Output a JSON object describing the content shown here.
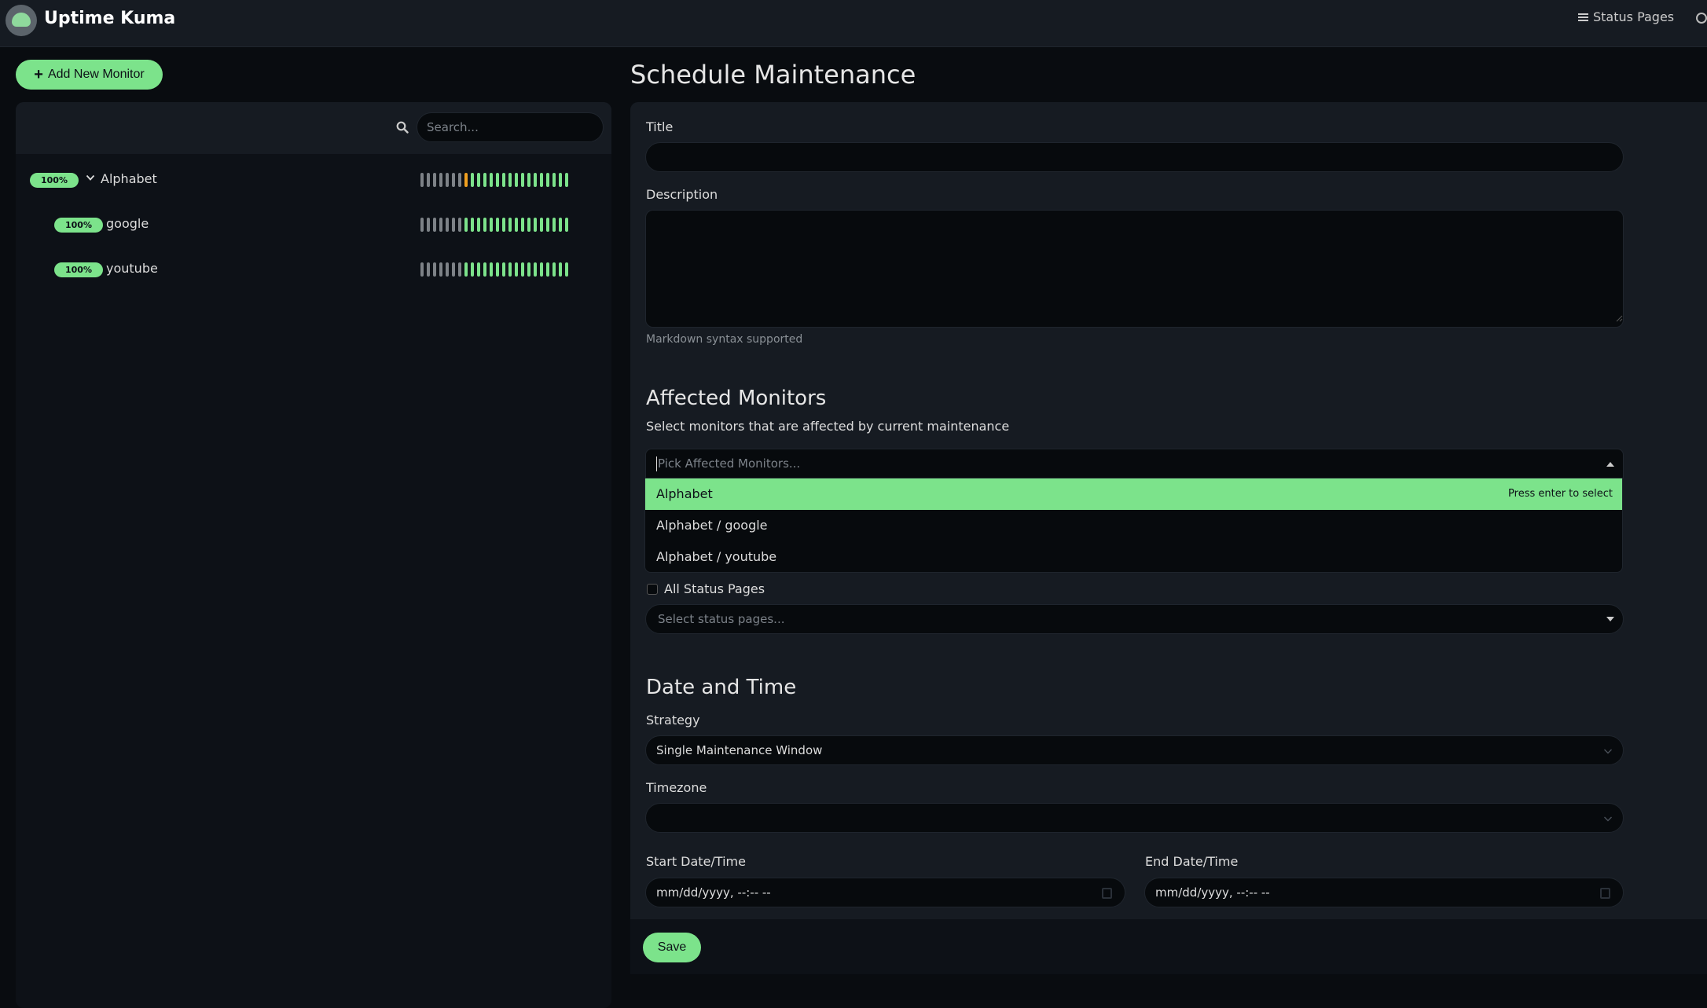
{
  "header": {
    "brand": "Uptime Kuma",
    "status_pages_label": "Status Pages"
  },
  "sidebar": {
    "add_monitor_label": "Add New Monitor",
    "search_placeholder": "Search...",
    "monitors": [
      {
        "name": "Alphabet",
        "uptime": "100%",
        "group": true
      },
      {
        "name": "google",
        "uptime": "100%",
        "group": false
      },
      {
        "name": "youtube",
        "uptime": "100%",
        "group": false
      }
    ]
  },
  "main": {
    "page_title": "Schedule Maintenance",
    "title_label": "Title",
    "title_value": "",
    "description_label": "Description",
    "description_value": "",
    "markdown_hint": "Markdown syntax supported",
    "affected_heading": "Affected Monitors",
    "affected_sub": "Select monitors that are affected by current maintenance",
    "pick_placeholder": "Pick Affected Monitors...",
    "dropdown_options": [
      "Alphabet",
      "Alphabet / google",
      "Alphabet / youtube"
    ],
    "press_enter_hint": "Press enter to select",
    "all_status_pages_label": "All Status Pages",
    "status_pages_placeholder": "Select status pages...",
    "datetime_heading": "Date and Time",
    "strategy_label": "Strategy",
    "strategy_value": "Single Maintenance Window",
    "timezone_label": "Timezone",
    "timezone_value": "",
    "start_label": "Start Date/Time",
    "start_placeholder": "mm/dd/yyyy, --:-- --",
    "end_label": "End Date/Time",
    "end_placeholder": "mm/dd/yyyy, --:-- --",
    "save_label": "Save"
  },
  "colors": {
    "accent": "#7ce38b",
    "background": "#090c10",
    "panel": "#161b22",
    "warning": "#f0a020"
  },
  "icons": {
    "logo": "uptime-kuma-logo",
    "search": "search-icon",
    "menu": "list-icon",
    "chevron": "chevron-down-icon",
    "calendar": "calendar-icon"
  }
}
